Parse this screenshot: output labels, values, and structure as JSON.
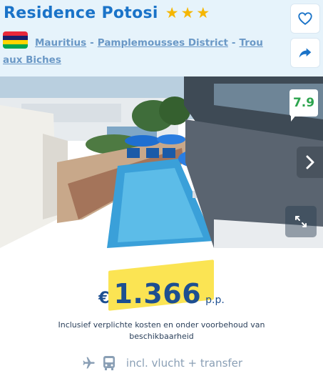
{
  "hotel": {
    "name": "Residence Potosi",
    "stars": 3
  },
  "location": {
    "flag_colors": [
      "#ea2839",
      "#1a206d",
      "#ffd500",
      "#00a551"
    ],
    "country": "Mauritius",
    "region": "Pamplemousses District",
    "city": "Trou aux Biches",
    "separator": "-"
  },
  "actions": {
    "favorite_icon": "heart-icon",
    "share_icon": "share-arrow-icon"
  },
  "photo": {
    "rating": "7.9",
    "next_icon": "chevron-right-icon",
    "expand_icon": "expand-icon"
  },
  "price": {
    "currency": "€",
    "amount": "1.366",
    "per": "p.p.",
    "note": "Inclusief verplichte kosten en onder voorbehoud van beschikbaarheid",
    "includes": "incl. vlucht + transfer",
    "include_icons": [
      "plane-icon",
      "bus-icon"
    ]
  },
  "colors": {
    "title": "#1a73c8",
    "header_bg": "#e6f3fb",
    "star": "#f5b600",
    "rating": "#2da44e",
    "price_highlight": "#fbe34a",
    "price_text": "#1d4f91"
  }
}
